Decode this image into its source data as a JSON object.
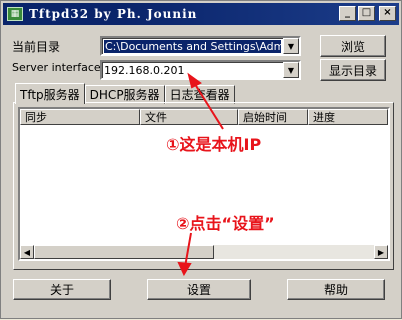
{
  "window": {
    "title": "Tftpd32 by Ph. Jounin",
    "app_icon": "tftp-app-icon"
  },
  "title_controls": {
    "minimize": "_",
    "maximize": "□",
    "close": "×"
  },
  "current_dir": {
    "label": "当前目录",
    "value": "C:\\Documents and Settings\\Administrator"
  },
  "server_interfaces": {
    "label": "Server interfaces",
    "value": "192.168.0.201"
  },
  "buttons": {
    "browse": "浏览",
    "show_dir": "显示目录",
    "about": "关于",
    "settings": "设置",
    "help": "帮助"
  },
  "tabs": [
    "Tftp服务器",
    "DHCP服务器",
    "日志查看器"
  ],
  "table": {
    "columns": [
      "同步",
      "文件",
      "启始时间",
      "进度"
    ]
  },
  "annotations": {
    "ip_note": "①这是本机IP",
    "settings_note": "②点击“设置”"
  },
  "colors": {
    "annotation": "#e8141b",
    "title_bar": "#0a246a",
    "selection": "#0a246a"
  }
}
